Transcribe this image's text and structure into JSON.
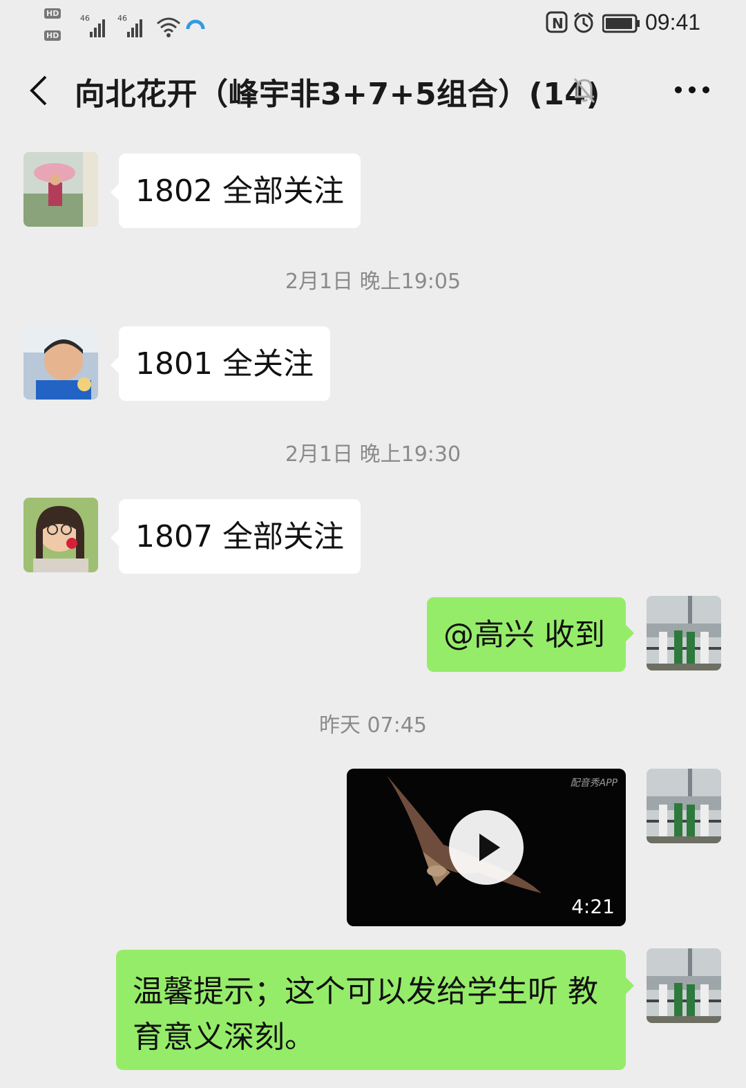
{
  "status_bar": {
    "time": "09:41",
    "network_labels": [
      "HD",
      "HD",
      "46",
      "46"
    ]
  },
  "header": {
    "title": "向北花开（峰宇非3+7+5组合）(14)"
  },
  "messages": [
    {
      "type": "text",
      "direction": "in",
      "text": "1802 全部关注"
    },
    {
      "type": "timestamp",
      "text": "2月1日 晚上19:05"
    },
    {
      "type": "text",
      "direction": "in",
      "text": "1801 全关注"
    },
    {
      "type": "timestamp",
      "text": "2月1日 晚上19:30"
    },
    {
      "type": "text",
      "direction": "in",
      "text": "1807 全部关注"
    },
    {
      "type": "text",
      "direction": "out",
      "text": "@高兴  收到"
    },
    {
      "type": "timestamp",
      "text": "昨天 07:45"
    },
    {
      "type": "video",
      "direction": "out",
      "duration": "4:21",
      "watermark": "配音秀APP"
    },
    {
      "type": "text",
      "direction": "out",
      "text": "温馨提示；这个可以发给学生听 教育意义深刻。"
    }
  ],
  "colors": {
    "background": "#ededed",
    "incoming_bubble": "#ffffff",
    "outgoing_bubble": "#95ec69"
  },
  "icons": [
    "back-arrow-icon",
    "mute-bell-icon",
    "more-dots-icon",
    "nfc-icon",
    "alarm-icon",
    "battery-icon",
    "wifi-icon",
    "signal-icon",
    "play-icon"
  ]
}
